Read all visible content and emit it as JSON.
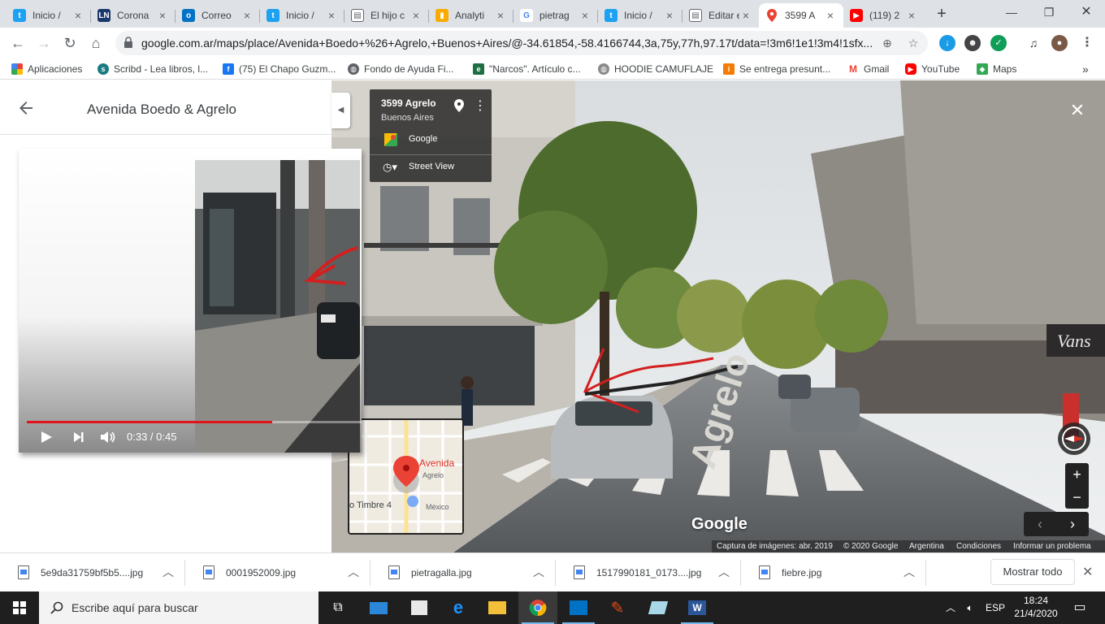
{
  "browser": {
    "tabs": [
      {
        "title": "Inicio /",
        "icon": "twitter-icon"
      },
      {
        "title": "Corona",
        "icon": "ln-icon"
      },
      {
        "title": "Correo",
        "icon": "outlook-icon"
      },
      {
        "title": "Inicio /",
        "icon": "twitter-icon"
      },
      {
        "title": "El hijo c",
        "icon": "page-icon"
      },
      {
        "title": "Analyti",
        "icon": "analytics-icon"
      },
      {
        "title": "pietrag",
        "icon": "google-icon"
      },
      {
        "title": "Inicio /",
        "icon": "twitter-icon"
      },
      {
        "title": "Editar e",
        "icon": "page-icon"
      },
      {
        "title": "3599 A",
        "icon": "maps-icon"
      },
      {
        "title": "(119) 2",
        "icon": "youtube-icon"
      }
    ],
    "new_tab": "+",
    "url": "google.com.ar/maps/place/Avenida+Boedo+%26+Agrelo,+Buenos+Aires/@-34.61854,-58.4166744,3a,75y,77h,97.17t/data=!3m6!1e1!3m4!1sfx...",
    "bookmarks": [
      {
        "label": "Aplicaciones",
        "icon": "apps-grid-icon"
      },
      {
        "label": "Scribd - Lea libros, l...",
        "icon": "scribd-icon"
      },
      {
        "label": "(75) El Chapo Guzm...",
        "icon": "facebook-icon"
      },
      {
        "label": "Fondo de Ayuda Fi...",
        "icon": "globe-icon"
      },
      {
        "label": "\"Narcos\". Artículo c...",
        "icon": "excel-icon"
      },
      {
        "label": "HOODIE CAMUFLAJE",
        "icon": "globe-icon"
      },
      {
        "label": "Se entrega presunt...",
        "icon": "info-icon"
      },
      {
        "label": "Gmail",
        "icon": "gmail-icon"
      },
      {
        "label": "YouTube",
        "icon": "youtube-icon"
      },
      {
        "label": "Maps",
        "icon": "maps-icon"
      }
    ],
    "bookmarks_overflow": "»"
  },
  "maps": {
    "panel_title": "Avenida Boedo & Agrelo",
    "video": {
      "time": "0:33 / 0:45",
      "progress": 0.733
    },
    "card": {
      "address": "3599 Agrelo",
      "city": "Buenos Aires",
      "source": "Google",
      "street_view": "Street View"
    },
    "minimap": {
      "label_main": "Avenida",
      "label_street": "Agrelo",
      "label_poi": "o Timbre 4",
      "label_mexico": "México"
    },
    "street_sign": "Agrelo",
    "logo": "Google",
    "shop_sign": "Vans",
    "attribution": {
      "capture": "Captura de imágenes: abr. 2019",
      "copyright": "© 2020 Google",
      "country": "Argentina",
      "terms": "Condiciones",
      "report": "Informar un problema"
    }
  },
  "downloads": {
    "items": [
      "5e9da31759bf5b5....jpg",
      "0001952009.jpg",
      "pietragalla.jpg",
      "1517990181_0173....jpg",
      "fiebre.jpg"
    ],
    "show_all": "Mostrar todo"
  },
  "taskbar": {
    "search_placeholder": "Escribe aquí para buscar",
    "lang": "ESP",
    "time": "18:24",
    "date": "21/4/2020"
  },
  "colors": {
    "maps_red": "#e3131b",
    "chrome_frame": "#dee1e6",
    "taskbar": "#1f1f1f"
  }
}
